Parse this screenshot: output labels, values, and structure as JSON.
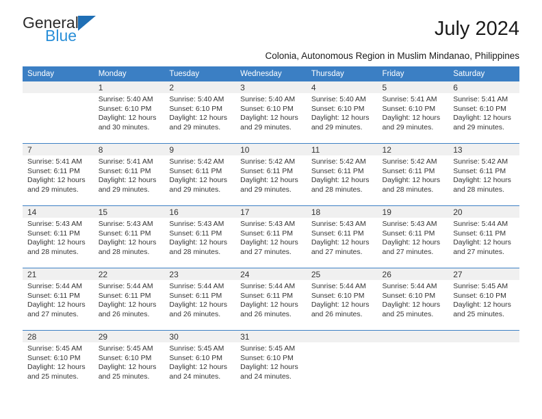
{
  "brand": {
    "name_top": "General",
    "name_bottom": "Blue",
    "triangle_color": "#1f6fb5",
    "blue_text_color": "#2a8fd8"
  },
  "header": {
    "month_title": "July 2024",
    "subtitle": "Colonia, Autonomous Region in Muslim Mindanao, Philippines"
  },
  "theme": {
    "header_bg": "#3b7fc4",
    "header_text": "#ffffff",
    "daynum_band_bg": "#f0f0f0",
    "body_text": "#333333",
    "row_divider": "#3b7fc4"
  },
  "weekday_headers": [
    "Sunday",
    "Monday",
    "Tuesday",
    "Wednesday",
    "Thursday",
    "Friday",
    "Saturday"
  ],
  "weeks": [
    [
      {
        "day": ""
      },
      {
        "day": "1",
        "sunrise": "Sunrise: 5:40 AM",
        "sunset": "Sunset: 6:10 PM",
        "daylight": "Daylight: 12 hours and 30 minutes."
      },
      {
        "day": "2",
        "sunrise": "Sunrise: 5:40 AM",
        "sunset": "Sunset: 6:10 PM",
        "daylight": "Daylight: 12 hours and 29 minutes."
      },
      {
        "day": "3",
        "sunrise": "Sunrise: 5:40 AM",
        "sunset": "Sunset: 6:10 PM",
        "daylight": "Daylight: 12 hours and 29 minutes."
      },
      {
        "day": "4",
        "sunrise": "Sunrise: 5:40 AM",
        "sunset": "Sunset: 6:10 PM",
        "daylight": "Daylight: 12 hours and 29 minutes."
      },
      {
        "day": "5",
        "sunrise": "Sunrise: 5:41 AM",
        "sunset": "Sunset: 6:10 PM",
        "daylight": "Daylight: 12 hours and 29 minutes."
      },
      {
        "day": "6",
        "sunrise": "Sunrise: 5:41 AM",
        "sunset": "Sunset: 6:10 PM",
        "daylight": "Daylight: 12 hours and 29 minutes."
      }
    ],
    [
      {
        "day": "7",
        "sunrise": "Sunrise: 5:41 AM",
        "sunset": "Sunset: 6:11 PM",
        "daylight": "Daylight: 12 hours and 29 minutes."
      },
      {
        "day": "8",
        "sunrise": "Sunrise: 5:41 AM",
        "sunset": "Sunset: 6:11 PM",
        "daylight": "Daylight: 12 hours and 29 minutes."
      },
      {
        "day": "9",
        "sunrise": "Sunrise: 5:42 AM",
        "sunset": "Sunset: 6:11 PM",
        "daylight": "Daylight: 12 hours and 29 minutes."
      },
      {
        "day": "10",
        "sunrise": "Sunrise: 5:42 AM",
        "sunset": "Sunset: 6:11 PM",
        "daylight": "Daylight: 12 hours and 29 minutes."
      },
      {
        "day": "11",
        "sunrise": "Sunrise: 5:42 AM",
        "sunset": "Sunset: 6:11 PM",
        "daylight": "Daylight: 12 hours and 28 minutes."
      },
      {
        "day": "12",
        "sunrise": "Sunrise: 5:42 AM",
        "sunset": "Sunset: 6:11 PM",
        "daylight": "Daylight: 12 hours and 28 minutes."
      },
      {
        "day": "13",
        "sunrise": "Sunrise: 5:42 AM",
        "sunset": "Sunset: 6:11 PM",
        "daylight": "Daylight: 12 hours and 28 minutes."
      }
    ],
    [
      {
        "day": "14",
        "sunrise": "Sunrise: 5:43 AM",
        "sunset": "Sunset: 6:11 PM",
        "daylight": "Daylight: 12 hours and 28 minutes."
      },
      {
        "day": "15",
        "sunrise": "Sunrise: 5:43 AM",
        "sunset": "Sunset: 6:11 PM",
        "daylight": "Daylight: 12 hours and 28 minutes."
      },
      {
        "day": "16",
        "sunrise": "Sunrise: 5:43 AM",
        "sunset": "Sunset: 6:11 PM",
        "daylight": "Daylight: 12 hours and 28 minutes."
      },
      {
        "day": "17",
        "sunrise": "Sunrise: 5:43 AM",
        "sunset": "Sunset: 6:11 PM",
        "daylight": "Daylight: 12 hours and 27 minutes."
      },
      {
        "day": "18",
        "sunrise": "Sunrise: 5:43 AM",
        "sunset": "Sunset: 6:11 PM",
        "daylight": "Daylight: 12 hours and 27 minutes."
      },
      {
        "day": "19",
        "sunrise": "Sunrise: 5:43 AM",
        "sunset": "Sunset: 6:11 PM",
        "daylight": "Daylight: 12 hours and 27 minutes."
      },
      {
        "day": "20",
        "sunrise": "Sunrise: 5:44 AM",
        "sunset": "Sunset: 6:11 PM",
        "daylight": "Daylight: 12 hours and 27 minutes."
      }
    ],
    [
      {
        "day": "21",
        "sunrise": "Sunrise: 5:44 AM",
        "sunset": "Sunset: 6:11 PM",
        "daylight": "Daylight: 12 hours and 27 minutes."
      },
      {
        "day": "22",
        "sunrise": "Sunrise: 5:44 AM",
        "sunset": "Sunset: 6:11 PM",
        "daylight": "Daylight: 12 hours and 26 minutes."
      },
      {
        "day": "23",
        "sunrise": "Sunrise: 5:44 AM",
        "sunset": "Sunset: 6:11 PM",
        "daylight": "Daylight: 12 hours and 26 minutes."
      },
      {
        "day": "24",
        "sunrise": "Sunrise: 5:44 AM",
        "sunset": "Sunset: 6:11 PM",
        "daylight": "Daylight: 12 hours and 26 minutes."
      },
      {
        "day": "25",
        "sunrise": "Sunrise: 5:44 AM",
        "sunset": "Sunset: 6:10 PM",
        "daylight": "Daylight: 12 hours and 26 minutes."
      },
      {
        "day": "26",
        "sunrise": "Sunrise: 5:44 AM",
        "sunset": "Sunset: 6:10 PM",
        "daylight": "Daylight: 12 hours and 25 minutes."
      },
      {
        "day": "27",
        "sunrise": "Sunrise: 5:45 AM",
        "sunset": "Sunset: 6:10 PM",
        "daylight": "Daylight: 12 hours and 25 minutes."
      }
    ],
    [
      {
        "day": "28",
        "sunrise": "Sunrise: 5:45 AM",
        "sunset": "Sunset: 6:10 PM",
        "daylight": "Daylight: 12 hours and 25 minutes."
      },
      {
        "day": "29",
        "sunrise": "Sunrise: 5:45 AM",
        "sunset": "Sunset: 6:10 PM",
        "daylight": "Daylight: 12 hours and 25 minutes."
      },
      {
        "day": "30",
        "sunrise": "Sunrise: 5:45 AM",
        "sunset": "Sunset: 6:10 PM",
        "daylight": "Daylight: 12 hours and 24 minutes."
      },
      {
        "day": "31",
        "sunrise": "Sunrise: 5:45 AM",
        "sunset": "Sunset: 6:10 PM",
        "daylight": "Daylight: 12 hours and 24 minutes."
      },
      {
        "day": ""
      },
      {
        "day": ""
      },
      {
        "day": ""
      }
    ]
  ]
}
